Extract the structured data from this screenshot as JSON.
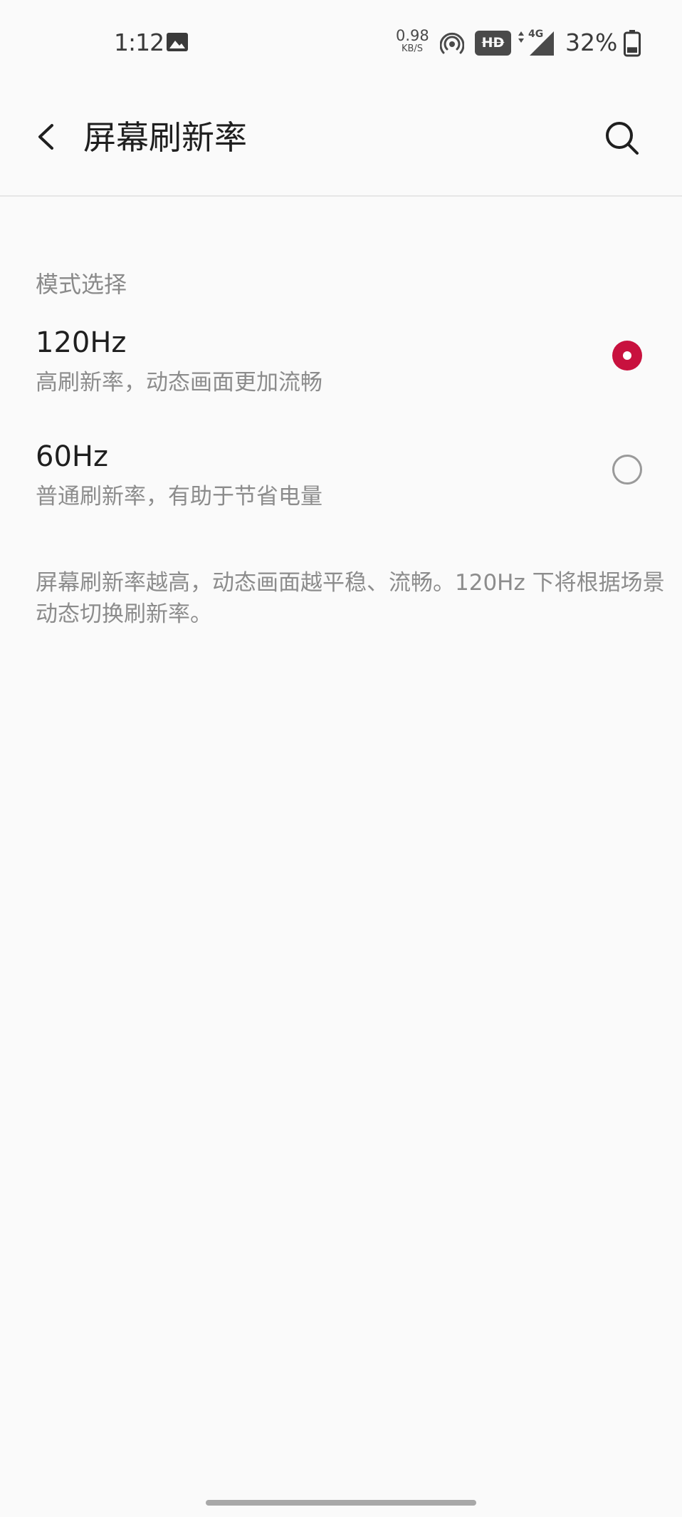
{
  "status_bar": {
    "time": "1:12",
    "net_speed_value": "0.98",
    "net_speed_unit": "KB/S",
    "hd_label": "HD",
    "network_label": "4G",
    "battery_percent": "32%",
    "battery_level": 0.32,
    "icons": [
      "image-icon",
      "hotspot-icon",
      "hd-badge",
      "signal-icon",
      "battery-icon"
    ]
  },
  "app_bar": {
    "title": "屏幕刷新率",
    "back_icon": "chevron-left-icon",
    "search_icon": "search-icon"
  },
  "section": {
    "header": "模式选择",
    "options": [
      {
        "title": "120Hz",
        "description": "高刷新率，动态画面更加流畅",
        "selected": true
      },
      {
        "title": "60Hz",
        "description": "普通刷新率，有助于节省电量",
        "selected": false
      }
    ]
  },
  "footer_note": "屏幕刷新率越高，动态画面越平稳、流畅。120Hz 下将根据场景动态切换刷新率。",
  "colors": {
    "accent": "#c8113e",
    "background": "#fafafa",
    "primary_text": "#1f1f1f",
    "secondary_text": "#8c8c8c"
  }
}
